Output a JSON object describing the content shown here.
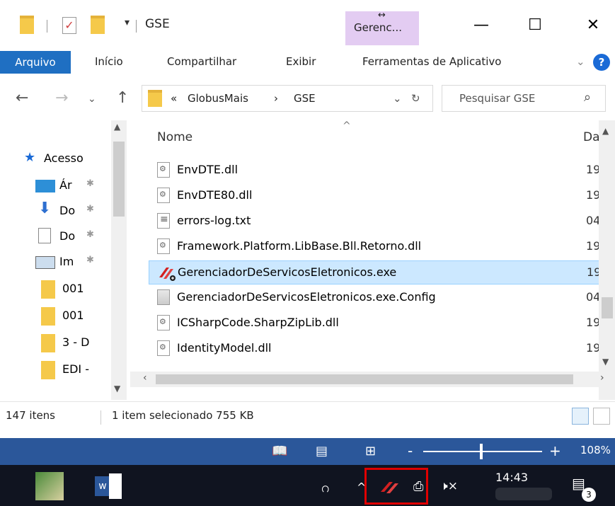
{
  "window": {
    "title": "GSE",
    "contextual_tab": "Gerenc...",
    "minimize_glyph": "—",
    "maximize_glyph": "☐",
    "close_glyph": "✕"
  },
  "ribbon": {
    "tabs": [
      "Arquivo",
      "Início",
      "Compartilhar",
      "Exibir",
      "Ferramentas de Aplicativo"
    ],
    "expand_glyph": "⌄",
    "help_glyph": "?"
  },
  "address": {
    "overflow": "«",
    "crumbs": [
      "GlobusMais",
      "GSE"
    ],
    "separator": "›",
    "search_placeholder": "Pesquisar GSE"
  },
  "navpane": {
    "items": [
      {
        "label": "Acesso",
        "icon": "star-icon"
      },
      {
        "label": "Ár",
        "icon": "desktop-icon",
        "pinned": true
      },
      {
        "label": "Do",
        "icon": "download-icon",
        "pinned": true
      },
      {
        "label": "Do",
        "icon": "documents-icon",
        "pinned": true
      },
      {
        "label": "Im",
        "icon": "pictures-icon",
        "pinned": true
      },
      {
        "label": "001",
        "icon": "folder-icon"
      },
      {
        "label": "001",
        "icon": "folder-icon"
      },
      {
        "label": "3 - D",
        "icon": "folder-icon"
      },
      {
        "label": "EDI -",
        "icon": "folder-icon"
      }
    ],
    "pin_glyph": "✱"
  },
  "filelist": {
    "column_name": "Nome",
    "column_date": "Da",
    "files": [
      {
        "name": "EnvDTE.dll",
        "date": "19",
        "type": "dll"
      },
      {
        "name": "EnvDTE80.dll",
        "date": "19",
        "type": "dll"
      },
      {
        "name": "errors-log.txt",
        "date": "04",
        "type": "txt"
      },
      {
        "name": "Framework.Platform.LibBase.Bll.Retorno.dll",
        "date": "19",
        "type": "dll"
      },
      {
        "name": "GerenciadorDeServicosEletronicos.exe",
        "date": "19",
        "type": "exe",
        "selected": true
      },
      {
        "name": "GerenciadorDeServicosEletronicos.exe.Config",
        "date": "04",
        "type": "cfg"
      },
      {
        "name": "ICSharpCode.SharpZipLib.dll",
        "date": "19",
        "type": "dll"
      },
      {
        "name": "IdentityModel.dll",
        "date": "19",
        "type": "dll"
      }
    ]
  },
  "status": {
    "item_count": "147 itens",
    "selection": "1 item selecionado  755 KB"
  },
  "wordbar": {
    "zoom": "108%",
    "zoom_value": 108,
    "minus": "-",
    "plus": "+"
  },
  "taskbar": {
    "clock": "14:43",
    "notifications": "3",
    "people_glyph": "ဂ",
    "chevron_glyph": "^",
    "volume_glyph": "🕨×"
  },
  "colors": {
    "accent": "#1f6fc2",
    "selection": "#cce8ff",
    "word_blue": "#2b579a",
    "taskbar": "#101420",
    "highlight": "#e00000"
  }
}
